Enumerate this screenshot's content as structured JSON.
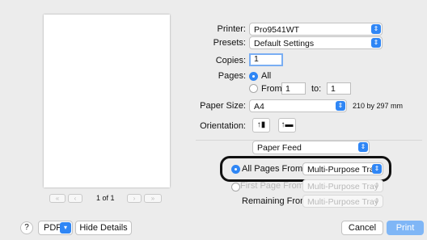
{
  "preview": {
    "page_counter": "1 of 1",
    "nav_first": "«",
    "nav_prev": "‹",
    "nav_next": "›",
    "nav_last": "»"
  },
  "printer": {
    "label": "Printer:",
    "value": "Pro9541WT"
  },
  "presets": {
    "label": "Presets:",
    "value": "Default Settings"
  },
  "copies": {
    "label": "Copies:",
    "value": "1"
  },
  "pages": {
    "label": "Pages:",
    "all_label": "All",
    "from_label": "From:",
    "from_value": "1",
    "to_label": "to:",
    "to_value": "1"
  },
  "paper_size": {
    "label": "Paper Size:",
    "value": "A4",
    "dimensions": "210 by 297 mm"
  },
  "orientation": {
    "label": "Orientation:"
  },
  "section": {
    "value": "Paper Feed"
  },
  "paper_feed": {
    "all_pages_from_label": "All Pages From:",
    "all_pages_from_value": "Multi-Purpose Tray",
    "first_page_from_label": "First Page From:",
    "first_page_from_value": "Multi-Purpose Tray",
    "remaining_from_label": "Remaining From:",
    "remaining_from_value": "Multi-Purpose Tray"
  },
  "footer": {
    "help": "?",
    "pdf": "PDF",
    "hide_details": "Hide Details",
    "cancel": "Cancel",
    "print": "Print"
  },
  "colors": {
    "accent": "#2f86f5",
    "print_button": "#7fb6f6",
    "background": "#ececec"
  }
}
